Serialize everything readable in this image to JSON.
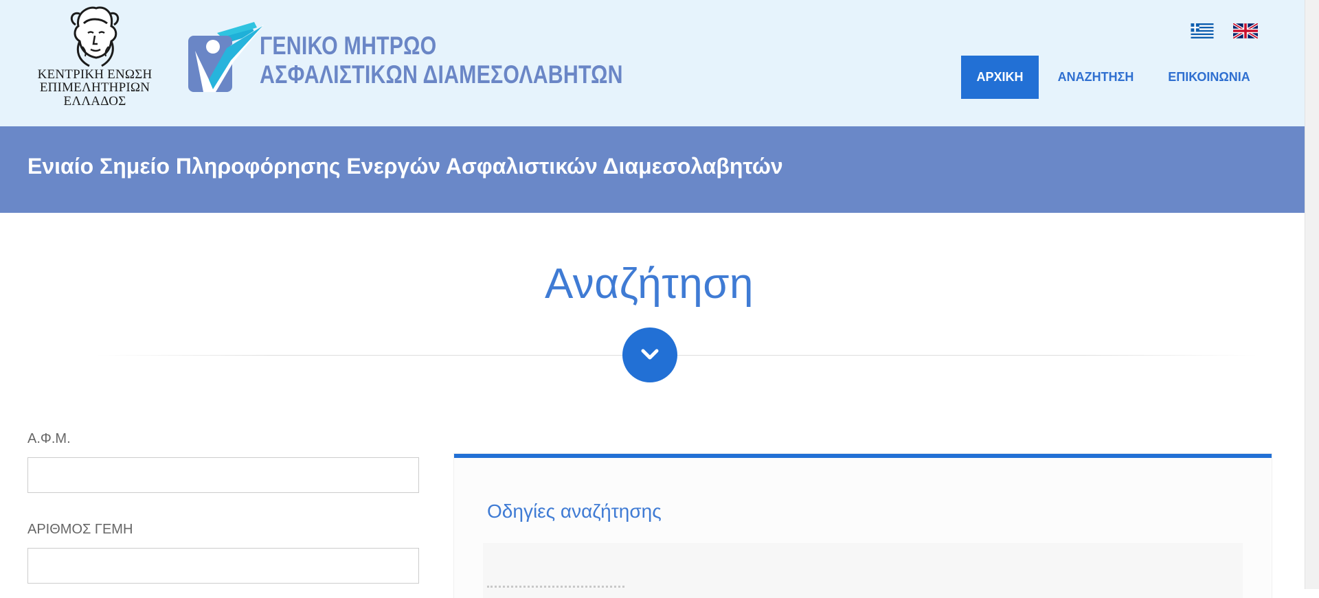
{
  "header": {
    "emblem": {
      "lines": [
        "ΚΕΝΤΡΙΚΗ ΕΝΩΣΗ",
        "ΕΠΙΜΕΛΗΤΗΡΙΩΝ",
        "ΕΛΛΑΔΟΣ"
      ],
      "icon": "hermes-head-icon"
    },
    "registry_logo": {
      "line1": "ΓΕΝΙΚΟ ΜΗΤΡΩΟ",
      "line2": "ΑΣΦΑΛΙΣΤΙΚΩΝ ΔΙΑΜΕΣΟΛΑΒΗΤΩΝ",
      "icon": "registry-person-check-icon"
    },
    "languages": [
      {
        "code": "el",
        "icon": "greek-flag-icon"
      },
      {
        "code": "en",
        "icon": "uk-flag-icon"
      }
    ],
    "nav": [
      {
        "label": "ΑΡΧΙΚΗ",
        "active": true
      },
      {
        "label": "ΑΝΑΖΗΤΗΣΗ",
        "active": false
      },
      {
        "label": "ΕΠΙΚΟΙΝΩΝΙΑ",
        "active": false
      }
    ]
  },
  "banner": {
    "title": "Ενιαίο Σημείο Πληροφόρησης Ενεργών Ασφαλιστικών Διαμεσολαβητών"
  },
  "section": {
    "title": "Αναζήτηση",
    "scroll_icon": "chevron-down-icon"
  },
  "form": {
    "afm_label": "Α.Φ.Μ.",
    "afm_value": "",
    "gemi_label": "ΑΡΙΘΜΟΣ ΓΕΜΗ",
    "gemi_value": ""
  },
  "help_panel": {
    "title": "Οδηγίες αναζήτησης"
  },
  "colors": {
    "header_bg": "#e6f3fc",
    "banner_bg": "#6a88c8",
    "accent": "#2270d5",
    "heading_blue": "#3f7bd4",
    "logo_blue": "#6a86c6"
  }
}
